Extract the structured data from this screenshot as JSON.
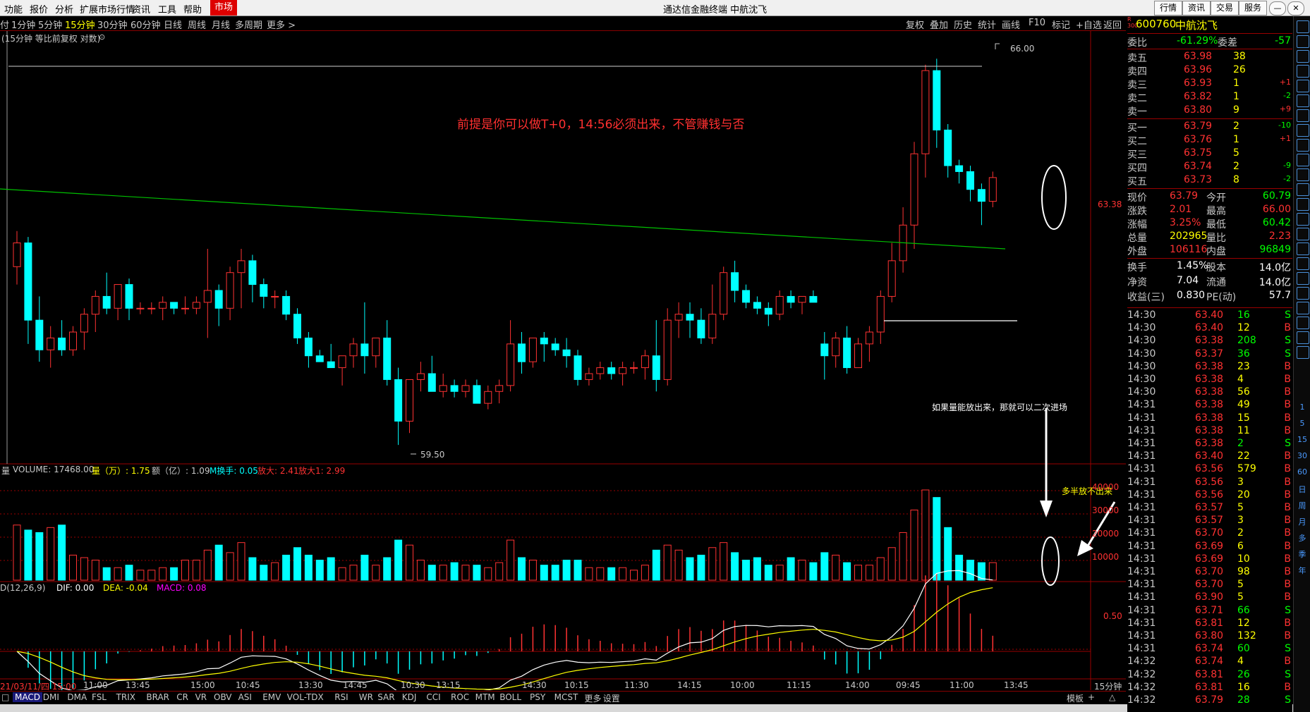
{
  "menu": {
    "items": [
      "功能",
      "报价",
      "分析",
      "扩展市场行情",
      "资讯",
      "工具",
      "帮助"
    ],
    "active": "市场",
    "window_title": "通达信金融终端  中航沈飞",
    "right_buttons": [
      "行情",
      "资讯",
      "交易",
      "服务"
    ]
  },
  "periods": {
    "items": [
      "1分钟",
      "5分钟",
      "15分钟",
      "30分钟",
      "60分钟",
      "日线",
      "周线",
      "月线",
      "多周期",
      "更多 >"
    ],
    "selected": "15分钟",
    "tools": [
      "复权",
      "叠加",
      "历史",
      "统计",
      "画线",
      "F10",
      "标记",
      "+自选",
      "返回"
    ]
  },
  "chart": {
    "title": "(15分钟 等比前复权 对数)",
    "price_high_label": "66.00",
    "price_low_label": "59.50",
    "right_axis_price": "63.38",
    "annotation_main": "前提是你可以做T+0，14:56必须出来，不管赚钱与否",
    "annotation_volume": "如果量能放出来，那就可以二次进场",
    "annotation_weak": "多半放不出来",
    "volume_header": {
      "name": "VOLUME: 17468.00",
      "liang": "量（万）: 1.75",
      "e": "额（亿）: 1.09",
      "hs": "M换手: 0.05",
      "fd1": "放大: 2.41",
      "fd2": "放大1: 2.99"
    },
    "volume_axis": [
      "40000",
      "30000",
      "20000",
      "10000"
    ],
    "macd_header": {
      "name": "D(12,26,9)",
      "dif": "DIF: 0.00",
      "dea": "DEA: -0.04",
      "macd": "MACD: 0.08"
    },
    "macd_axis": "0.50",
    "time_labels": [
      "21/03/11/四 15:00",
      "11:00",
      "13:45",
      "15:00",
      "10:45",
      "13:30",
      "14:45",
      "10:30",
      "13:15",
      "14:30",
      "10:15",
      "11:30",
      "14:15",
      "10:00",
      "11:15",
      "14:00",
      "09:45",
      "11:00",
      "13:45"
    ],
    "period_corner": "15分钟"
  },
  "chart_data": {
    "type": "candlestick",
    "ohlc": [
      [
        62.5,
        63.1,
        62.2,
        62.9
      ],
      [
        62.9,
        63.0,
        61.2,
        61.6
      ],
      [
        61.6,
        62.0,
        60.9,
        61.1
      ],
      [
        61.1,
        61.5,
        60.8,
        61.3
      ],
      [
        61.3,
        61.6,
        61.0,
        61.1
      ],
      [
        61.1,
        61.5,
        61.0,
        61.4
      ],
      [
        61.4,
        61.8,
        61.1,
        61.7
      ],
      [
        61.7,
        62.1,
        61.4,
        62.0
      ],
      [
        62.0,
        62.4,
        61.7,
        61.8
      ],
      [
        61.8,
        62.2,
        61.6,
        62.2
      ],
      [
        62.2,
        62.3,
        61.6,
        61.8
      ],
      [
        61.8,
        61.9,
        61.7,
        61.8
      ],
      [
        61.8,
        61.9,
        61.7,
        61.8
      ],
      [
        61.8,
        62.0,
        61.6,
        61.9
      ],
      [
        61.9,
        61.9,
        61.7,
        61.8
      ],
      [
        61.8,
        62.0,
        61.7,
        61.8
      ],
      [
        61.8,
        62.0,
        61.7,
        61.9
      ],
      [
        61.9,
        62.8,
        61.3,
        62.1
      ],
      [
        62.1,
        62.2,
        61.5,
        61.8
      ],
      [
        61.8,
        62.5,
        61.6,
        62.4
      ],
      [
        62.4,
        62.8,
        61.8,
        62.6
      ],
      [
        62.6,
        62.7,
        61.9,
        62.2
      ],
      [
        62.2,
        62.3,
        61.8,
        62.0
      ],
      [
        62.0,
        62.1,
        61.8,
        62.0
      ],
      [
        62.0,
        62.1,
        61.6,
        61.7
      ],
      [
        61.7,
        61.8,
        61.2,
        61.3
      ],
      [
        61.3,
        61.4,
        60.8,
        61.0
      ],
      [
        61.0,
        61.1,
        60.9,
        60.9
      ],
      [
        60.9,
        61.2,
        60.8,
        60.8
      ],
      [
        60.8,
        61.0,
        60.5,
        61.0
      ],
      [
        61.0,
        61.3,
        60.8,
        61.2
      ],
      [
        61.2,
        61.9,
        60.7,
        61.0
      ],
      [
        61.0,
        61.2,
        60.8,
        61.3
      ],
      [
        61.3,
        61.6,
        60.5,
        60.6
      ],
      [
        60.6,
        60.8,
        59.5,
        59.9
      ],
      [
        59.9,
        60.6,
        59.7,
        60.6
      ],
      [
        60.6,
        60.9,
        60.4,
        60.7
      ],
      [
        60.7,
        61.0,
        60.4,
        60.4
      ],
      [
        60.4,
        60.7,
        60.3,
        60.5
      ],
      [
        60.5,
        60.6,
        60.3,
        60.4
      ],
      [
        60.4,
        60.6,
        60.3,
        60.5
      ],
      [
        60.5,
        60.6,
        60.3,
        60.2
      ],
      [
        60.2,
        60.5,
        60.1,
        60.4
      ],
      [
        60.4,
        60.6,
        60.2,
        60.5
      ],
      [
        60.5,
        61.6,
        60.4,
        61.2
      ],
      [
        61.2,
        61.4,
        60.7,
        60.9
      ],
      [
        60.9,
        61.3,
        60.8,
        61.3
      ],
      [
        61.3,
        61.4,
        60.9,
        61.2
      ],
      [
        61.2,
        61.3,
        61.0,
        61.1
      ],
      [
        61.1,
        61.3,
        60.8,
        61.0
      ],
      [
        61.0,
        61.1,
        60.5,
        60.6
      ],
      [
        60.6,
        60.8,
        60.5,
        60.7
      ],
      [
        60.7,
        60.9,
        60.6,
        60.8
      ],
      [
        60.8,
        60.9,
        60.6,
        60.7
      ],
      [
        60.7,
        60.9,
        60.5,
        60.8
      ],
      [
        60.8,
        60.9,
        60.7,
        60.8
      ],
      [
        60.8,
        61.1,
        60.6,
        61.0
      ],
      [
        61.0,
        61.6,
        60.4,
        60.6
      ],
      [
        60.6,
        61.8,
        60.5,
        61.6
      ],
      [
        61.6,
        61.9,
        61.3,
        61.7
      ],
      [
        61.7,
        61.9,
        61.3,
        61.6
      ],
      [
        61.6,
        61.8,
        61.2,
        61.3
      ],
      [
        61.3,
        62.2,
        61.2,
        61.7
      ],
      [
        61.7,
        62.5,
        61.6,
        62.4
      ],
      [
        62.4,
        62.6,
        61.9,
        62.1
      ],
      [
        62.1,
        62.2,
        61.8,
        61.9
      ],
      [
        61.9,
        62.0,
        61.7,
        61.8
      ],
      [
        61.8,
        61.9,
        61.5,
        61.7
      ],
      [
        61.7,
        62.1,
        61.6,
        62.0
      ],
      [
        62.0,
        62.1,
        61.8,
        61.9
      ],
      [
        61.9,
        62.0,
        61.7,
        62.0
      ],
      [
        62.0,
        62.1,
        61.9,
        61.9
      ],
      [
        61.2,
        61.4,
        60.6,
        61.0
      ],
      [
        61.0,
        61.4,
        60.8,
        61.3
      ],
      [
        61.3,
        61.5,
        60.7,
        60.8
      ],
      [
        60.8,
        61.3,
        60.8,
        61.2
      ],
      [
        61.2,
        61.5,
        60.9,
        61.4
      ],
      [
        61.4,
        62.1,
        61.2,
        62.0
      ],
      [
        62.0,
        62.9,
        61.9,
        62.6
      ],
      [
        62.6,
        63.5,
        62.4,
        63.2
      ],
      [
        63.2,
        64.6,
        62.8,
        64.4
      ],
      [
        64.4,
        65.9,
        64.0,
        65.8
      ],
      [
        65.8,
        66.0,
        64.5,
        64.8
      ],
      [
        64.8,
        64.9,
        64.0,
        64.2
      ],
      [
        64.2,
        64.3,
        63.9,
        64.1
      ],
      [
        64.1,
        64.2,
        63.6,
        63.8
      ],
      [
        63.8,
        63.9,
        63.2,
        63.6
      ],
      [
        63.6,
        64.1,
        63.5,
        64.0
      ]
    ],
    "volume": [
      2.2,
      2.0,
      1.9,
      2.1,
      2.2,
      1.0,
      0.9,
      0.8,
      0.5,
      0.5,
      0.6,
      0.4,
      0.4,
      0.5,
      0.5,
      0.8,
      0.8,
      1.2,
      1.4,
      1.1,
      1.5,
      0.9,
      0.6,
      0.7,
      1.0,
      1.3,
      1.0,
      0.8,
      0.9,
      0.5,
      0.6,
      1.0,
      0.6,
      0.9,
      1.6,
      1.4,
      0.8,
      0.6,
      0.6,
      0.7,
      0.6,
      0.6,
      0.5,
      0.7,
      1.6,
      0.9,
      0.8,
      0.6,
      0.6,
      0.8,
      0.8,
      0.5,
      0.5,
      0.5,
      0.5,
      0.4,
      0.6,
      1.2,
      1.4,
      1.2,
      0.9,
      1.0,
      1.3,
      1.5,
      1.1,
      0.8,
      0.9,
      0.6,
      0.6,
      0.9,
      0.8,
      0.7,
      1.1,
      1.0,
      0.7,
      0.6,
      0.6,
      0.9,
      1.3,
      1.9,
      2.8,
      3.6,
      3.3,
      2.1,
      1.0,
      0.8,
      0.7,
      0.7
    ],
    "ylim": [
      59.3,
      66.3
    ],
    "vol_ylim": [
      0,
      45000
    ]
  },
  "quote": {
    "code": "600760",
    "name": "中航沈飞",
    "wei_bi_label": "委比",
    "wei_bi": "-61.29%",
    "wei_cha_label": "委差",
    "wei_cha": "-57",
    "asks": [
      {
        "label": "卖五",
        "price": "63.98",
        "vol": "38",
        "chg": ""
      },
      {
        "label": "卖四",
        "price": "63.96",
        "vol": "26",
        "chg": ""
      },
      {
        "label": "卖三",
        "price": "63.93",
        "vol": "1",
        "chg": "+1"
      },
      {
        "label": "卖二",
        "price": "63.82",
        "vol": "1",
        "chg": "-2"
      },
      {
        "label": "卖一",
        "price": "63.80",
        "vol": "9",
        "chg": "+9"
      }
    ],
    "bids": [
      {
        "label": "买一",
        "price": "63.79",
        "vol": "2",
        "chg": "-10"
      },
      {
        "label": "买二",
        "price": "63.76",
        "vol": "1",
        "chg": "+1"
      },
      {
        "label": "买三",
        "price": "63.75",
        "vol": "5",
        "chg": ""
      },
      {
        "label": "买四",
        "price": "63.74",
        "vol": "2",
        "chg": "-9"
      },
      {
        "label": "买五",
        "price": "63.73",
        "vol": "8",
        "chg": "-2"
      }
    ],
    "stats": [
      {
        "l1": "现价",
        "v1": "63.79",
        "l2": "今开",
        "v2": "60.79"
      },
      {
        "l1": "涨跌",
        "v1": "2.01",
        "l2": "最高",
        "v2": "66.00"
      },
      {
        "l1": "涨幅",
        "v1": "3.25%",
        "l2": "最低",
        "v2": "60.42"
      },
      {
        "l1": "总量",
        "v1": "202965",
        "l2": "量比",
        "v2": "2.23"
      },
      {
        "l1": "外盘",
        "v1": "106116",
        "l2": "内盘",
        "v2": "96849"
      }
    ],
    "stats2": [
      {
        "l1": "换手",
        "v1": "1.45%",
        "l2": "股本",
        "v2": "14.0亿"
      },
      {
        "l1": "净资",
        "v1": "7.04",
        "l2": "流通",
        "v2": "14.0亿"
      },
      {
        "l1": "收益(三)",
        "v1": "0.830",
        "l2": "PE(动)",
        "v2": "57.7"
      }
    ],
    "ticks": [
      {
        "t": "14:30",
        "p": "63.40",
        "v": "16",
        "d": "S"
      },
      {
        "t": "14:30",
        "p": "63.40",
        "v": "12",
        "d": "B"
      },
      {
        "t": "14:30",
        "p": "63.38",
        "v": "208",
        "d": "S"
      },
      {
        "t": "14:30",
        "p": "63.37",
        "v": "36",
        "d": "S"
      },
      {
        "t": "14:30",
        "p": "63.38",
        "v": "23",
        "d": "B"
      },
      {
        "t": "14:30",
        "p": "63.38",
        "v": "4",
        "d": "B"
      },
      {
        "t": "14:30",
        "p": "63.38",
        "v": "56",
        "d": "B"
      },
      {
        "t": "14:31",
        "p": "63.38",
        "v": "49",
        "d": "B"
      },
      {
        "t": "14:31",
        "p": "63.38",
        "v": "15",
        "d": "B"
      },
      {
        "t": "14:31",
        "p": "63.38",
        "v": "11",
        "d": "B"
      },
      {
        "t": "14:31",
        "p": "63.38",
        "v": "2",
        "d": "S"
      },
      {
        "t": "14:31",
        "p": "63.40",
        "v": "22",
        "d": "B"
      },
      {
        "t": "14:31",
        "p": "63.56",
        "v": "579",
        "d": "B"
      },
      {
        "t": "14:31",
        "p": "63.56",
        "v": "3",
        "d": "B"
      },
      {
        "t": "14:31",
        "p": "63.56",
        "v": "20",
        "d": "B"
      },
      {
        "t": "14:31",
        "p": "63.57",
        "v": "5",
        "d": "B"
      },
      {
        "t": "14:31",
        "p": "63.57",
        "v": "3",
        "d": "B"
      },
      {
        "t": "14:31",
        "p": "63.70",
        "v": "2",
        "d": "B"
      },
      {
        "t": "14:31",
        "p": "63.69",
        "v": "6",
        "d": "B"
      },
      {
        "t": "14:31",
        "p": "63.69",
        "v": "10",
        "d": "B"
      },
      {
        "t": "14:31",
        "p": "63.70",
        "v": "98",
        "d": "B"
      },
      {
        "t": "14:31",
        "p": "63.70",
        "v": "5",
        "d": "B"
      },
      {
        "t": "14:31",
        "p": "63.90",
        "v": "5",
        "d": "B"
      },
      {
        "t": "14:31",
        "p": "63.71",
        "v": "66",
        "d": "S"
      },
      {
        "t": "14:31",
        "p": "63.81",
        "v": "12",
        "d": "B"
      },
      {
        "t": "14:31",
        "p": "63.80",
        "v": "132",
        "d": "B"
      },
      {
        "t": "14:31",
        "p": "63.74",
        "v": "60",
        "d": "S"
      },
      {
        "t": "14:32",
        "p": "63.74",
        "v": "4",
        "d": "B"
      },
      {
        "t": "14:32",
        "p": "63.81",
        "v": "26",
        "d": "S"
      },
      {
        "t": "14:32",
        "p": "63.81",
        "v": "16",
        "d": "B"
      },
      {
        "t": "14:32",
        "p": "63.79",
        "v": "28",
        "d": "S"
      }
    ]
  },
  "right_toolbar": [
    "1",
    "5",
    "15",
    "30",
    "60",
    "日",
    "周",
    "月",
    "多",
    "季",
    "年"
  ],
  "bottom_tabs": [
    "MACD",
    "DMI",
    "DMA",
    "FSL",
    "TRIX",
    "BRAR",
    "CR",
    "VR",
    "OBV",
    "ASI",
    "EMV",
    "VOL-TDX",
    "RSI",
    "WR",
    "SAR",
    "KDJ",
    "CCI",
    "ROC",
    "MTM",
    "BOLL",
    "PSY",
    "MCST",
    "更多",
    "设置"
  ],
  "bottom_right_btns": [
    "模板",
    "+",
    "△"
  ],
  "colors": {
    "up": "#ff3232",
    "down": "#00ffff",
    "grid": "#9a0000",
    "yellow": "#ffff00",
    "magenta": "#ff00ff",
    "green": "#00c000"
  }
}
